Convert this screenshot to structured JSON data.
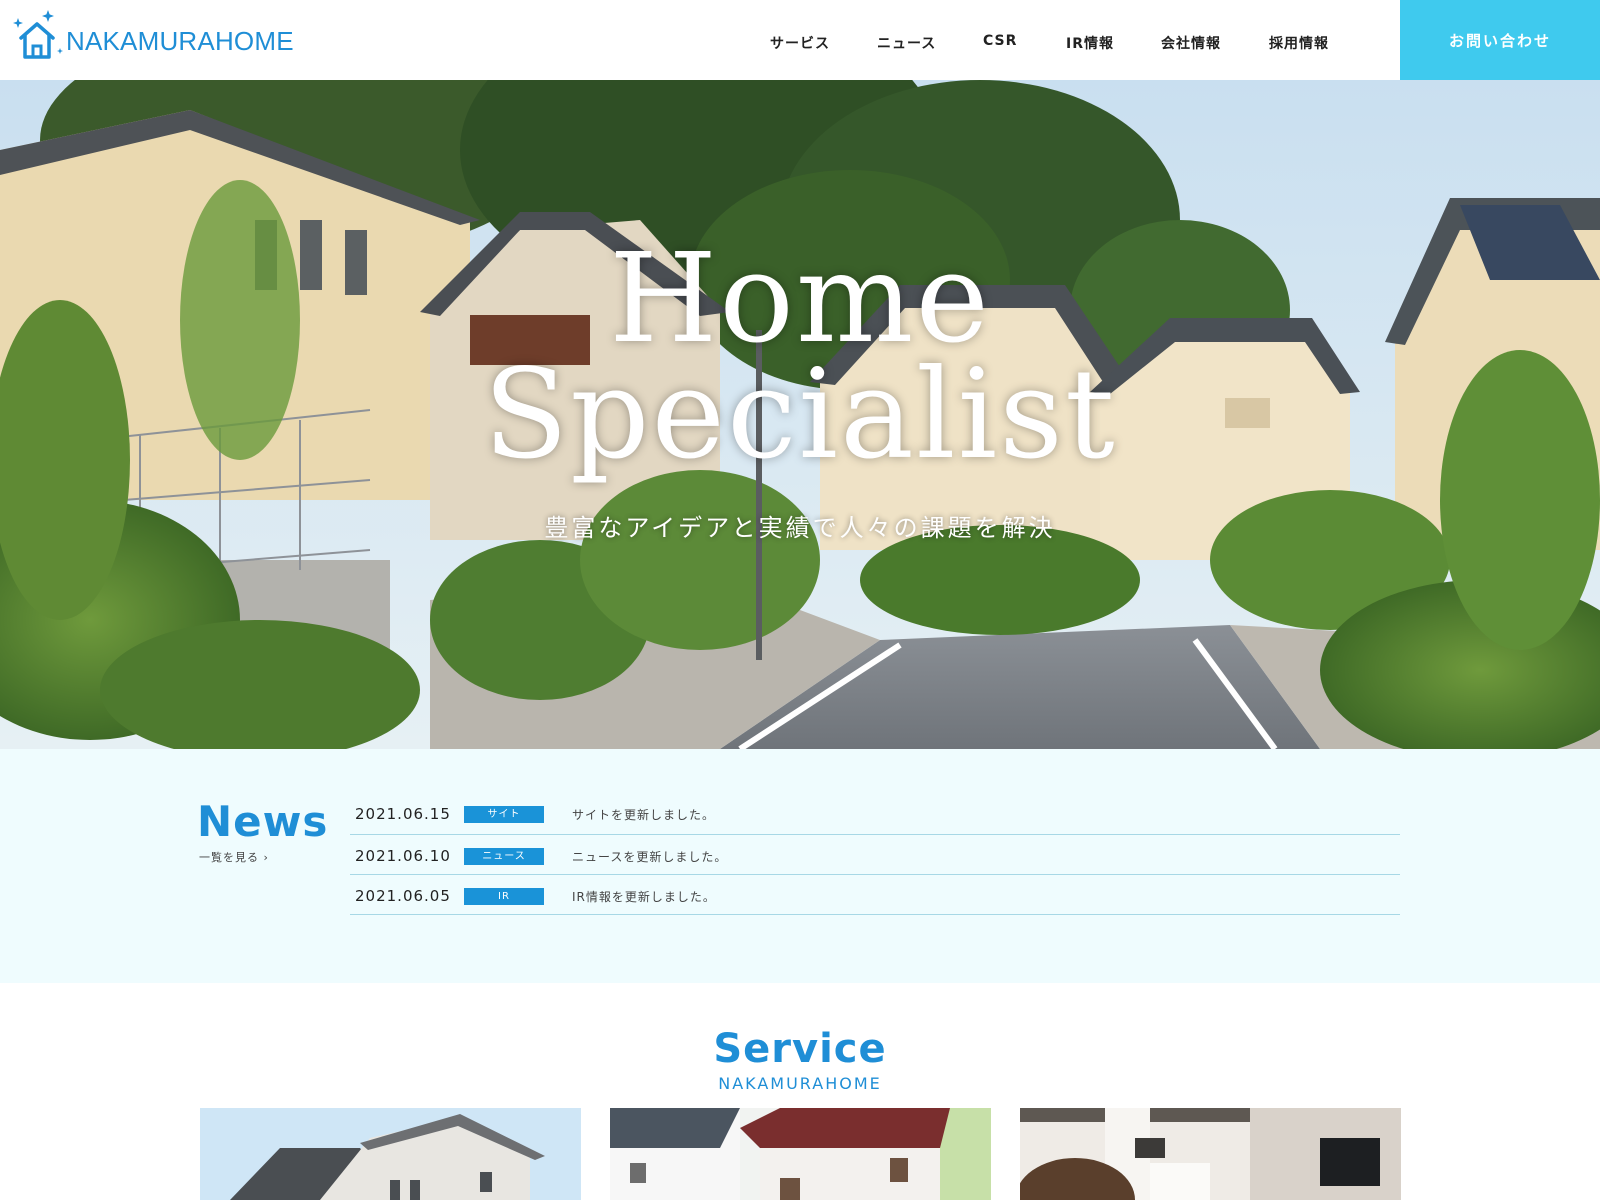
{
  "header": {
    "logo_text": "NAKAMURAHOME",
    "nav": [
      "サービス",
      "ニュース",
      "CSR",
      "IR情報",
      "会社情報",
      "採用情報"
    ],
    "contact_label": "お問い合わせ"
  },
  "hero": {
    "title_line1": "Home",
    "title_line2": "Specialist",
    "subtitle": "豊富なアイデアと実績で人々の課題を解決"
  },
  "news": {
    "title": "News",
    "more_label": "一覧を見る ›",
    "items": [
      {
        "date": "2021.06.15",
        "tag": "サイト",
        "text": "サイトを更新しました。"
      },
      {
        "date": "2021.06.10",
        "tag": "ニュース",
        "text": "ニュースを更新しました。"
      },
      {
        "date": "2021.06.05",
        "tag": "IR",
        "text": "IR情報を更新しました。"
      }
    ]
  },
  "service": {
    "title": "Service",
    "subtitle": "NAKAMURAHOME"
  },
  "colors": {
    "brand": "#1f8ed6",
    "contact_bg": "#3fcaee",
    "news_bg": "#effcfe",
    "tag_bg": "#1a93d8"
  },
  "icons": [
    "house-logo-icon",
    "sparkle-icon",
    "chevron-right-icon"
  ]
}
